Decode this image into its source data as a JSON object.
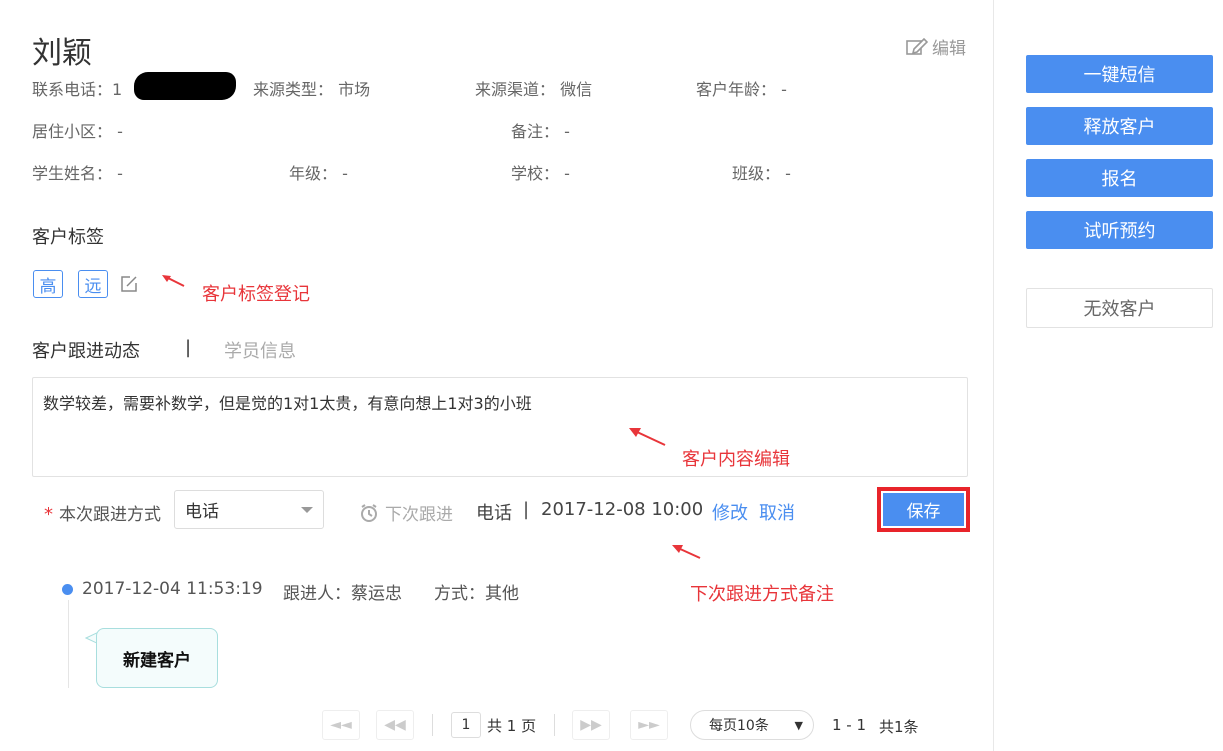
{
  "customer": {
    "name": "刘颖",
    "edit_label": "编辑",
    "phone_label": "联系电话：",
    "phone_value": "1",
    "source_type_label": "来源类型：",
    "source_type_value": "市场",
    "source_channel_label": "来源渠道：",
    "source_channel_value": "微信",
    "age_label": "客户年龄：",
    "age_value": "-",
    "community_label": "居住小区：",
    "community_value": "-",
    "remark_label": "备注：",
    "remark_value": "-",
    "student_name_label": "学生姓名：",
    "student_name_value": "-",
    "grade_label": "年级：",
    "grade_value": "-",
    "school_label": "学校：",
    "school_value": "-",
    "class_label": "班级：",
    "class_value": "-"
  },
  "tags": {
    "title": "客户标签",
    "items": [
      "高",
      "远"
    ],
    "annotation": "客户标签登记"
  },
  "tabs": {
    "active": "客户跟进动态",
    "separator": "|",
    "inactive": "学员信息"
  },
  "followup": {
    "content": "数学较差，需要补数学，但是觉的1对1太贵，有意向想上1对3的小班",
    "content_annotation": "客户内容编辑",
    "required_mark": "*",
    "method_label": "本次跟进方式",
    "method_value": "电话",
    "next_label": "下次跟进",
    "next_method": "电话",
    "next_sep": "|",
    "next_time": "2017-12-08 10:00",
    "modify_label": "修改",
    "cancel_label": "取消",
    "save_label": "保存",
    "next_annotation": "下次跟进方式备注"
  },
  "timeline": {
    "time": "2017-12-04 11:53:19",
    "person": "跟进人：蔡运忠",
    "method": "方式：其他",
    "bubble": "新建客户"
  },
  "pagination": {
    "page_value": "1",
    "total_pages": "共 1 页",
    "per_page": "每页10条",
    "range": "1 - 1",
    "total": "共1条"
  },
  "sidebar": {
    "sms": "一键短信",
    "release": "释放客户",
    "enroll": "报名",
    "trial": "试听预约",
    "invalid": "无效客户"
  },
  "colors": {
    "accent": "#4a8ef0",
    "annotation": "#e8353a",
    "highlight_border": "#e8242a"
  }
}
